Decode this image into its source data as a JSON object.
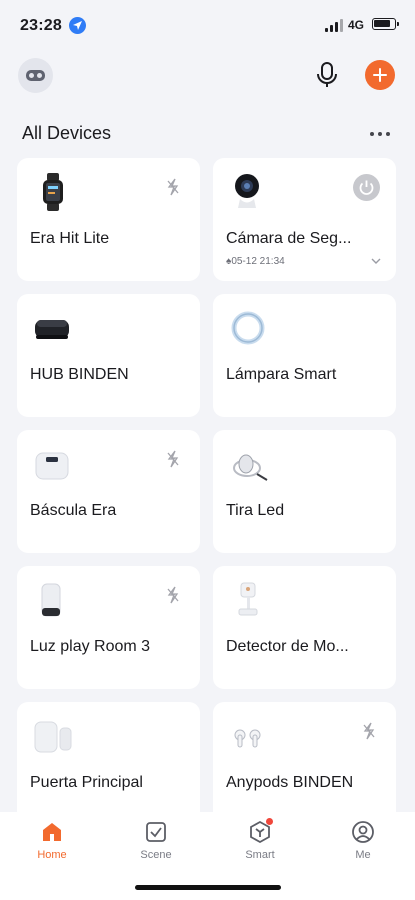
{
  "status_bar": {
    "time": "23:28",
    "network": "4G",
    "battery_level": 0.85,
    "icons": [
      "location-icon",
      "signal-icon",
      "battery-icon"
    ]
  },
  "header": {
    "avatar_icon": "home-avatar-icon",
    "mic_icon": "microphone-icon",
    "add_icon": "plus-icon",
    "accent_color": "#f26a2e"
  },
  "section": {
    "title": "All Devices",
    "more_icon": "more-dots-icon"
  },
  "devices": [
    {
      "name": "Era Hit Lite",
      "icon": "smartwatch-icon",
      "status": "offline-icon"
    },
    {
      "name": "Cámara de Seg...",
      "icon": "camera-icon",
      "status": "power-icon",
      "event_icon": "bell-icon",
      "timestamp": "05-12 21:34"
    },
    {
      "name": "HUB BINDEN",
      "icon": "ir-hub-icon"
    },
    {
      "name": "Lámpara Smart",
      "icon": "ring-lamp-icon"
    },
    {
      "name": "Báscula Era",
      "icon": "scale-icon",
      "status": "offline-icon"
    },
    {
      "name": "Tira Led",
      "icon": "led-strip-icon"
    },
    {
      "name": "Luz play Room 3",
      "icon": "speaker-light-icon",
      "status": "offline-icon"
    },
    {
      "name": "Detector de Mo...",
      "icon": "motion-detector-icon"
    },
    {
      "name": "Puerta Principal",
      "icon": "door-sensor-icon"
    },
    {
      "name": "Anypods BINDEN",
      "icon": "earbuds-icon",
      "status": "offline-icon"
    }
  ],
  "tab_bar": {
    "tabs": [
      {
        "label": "Home",
        "icon": "home-icon",
        "active": true
      },
      {
        "label": "Scene",
        "icon": "scene-checkbox-icon",
        "active": false
      },
      {
        "label": "Smart",
        "icon": "smart-icon",
        "active": false,
        "badge": true
      },
      {
        "label": "Me",
        "icon": "user-icon",
        "active": false
      }
    ]
  }
}
